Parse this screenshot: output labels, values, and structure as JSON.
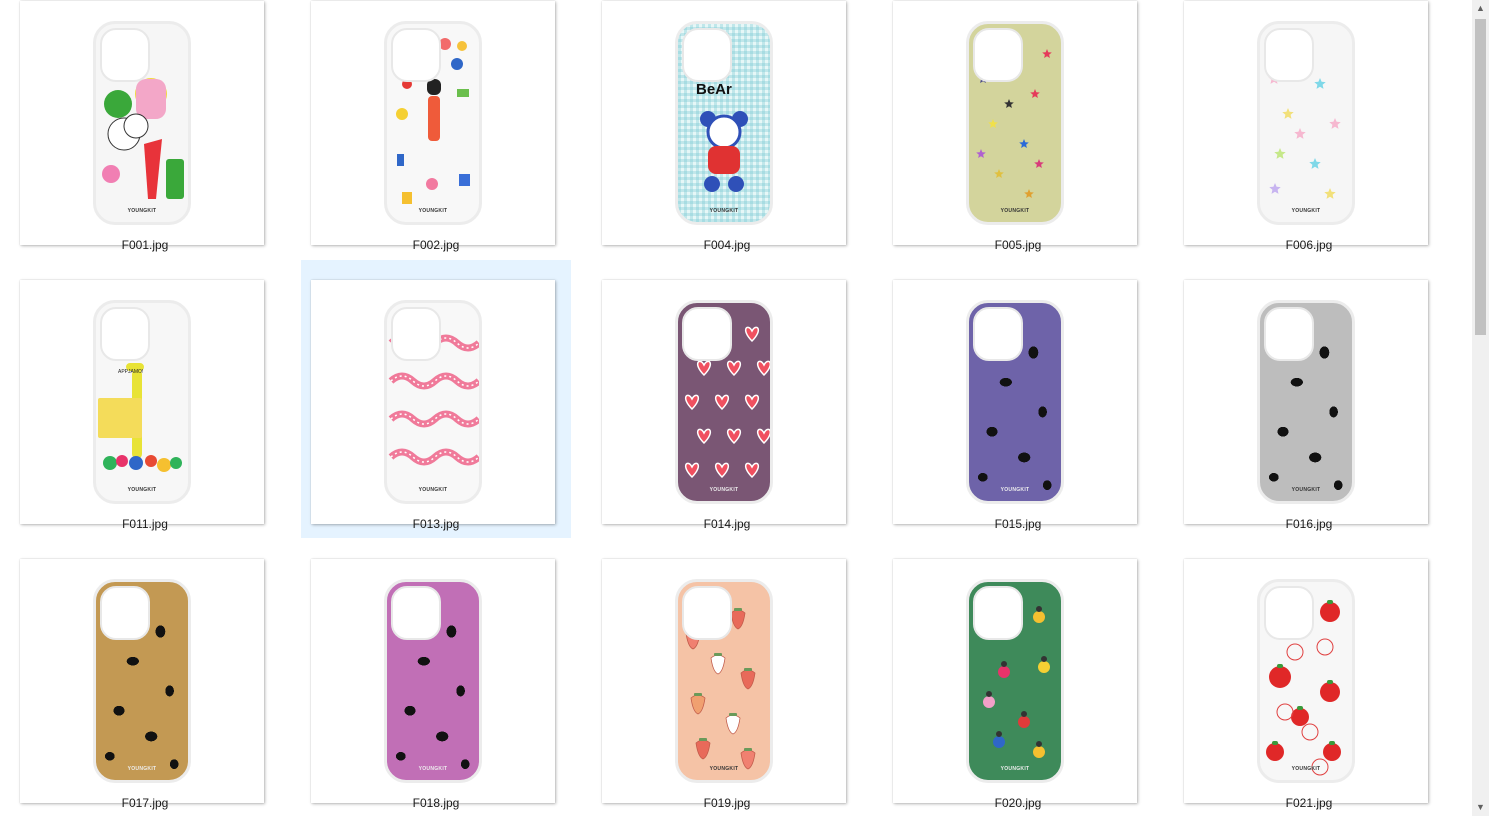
{
  "files": [
    {
      "name": "F001.jpg",
      "design": "doodle-heart-cloud",
      "bg": "#f6f6f6",
      "brand": "YOUNGKIT"
    },
    {
      "name": "F002.jpg",
      "design": "girl-stickers",
      "bg": "#f8f8f8",
      "brand": "YOUNGKIT"
    },
    {
      "name": "F004.jpg",
      "design": "bear-gingham",
      "bg": "#c8ecec",
      "brand": "YOUNGKIT",
      "text": "BeAr"
    },
    {
      "name": "F005.jpg",
      "design": "stars-olive",
      "bg": "#d3d49c",
      "brand": "YOUNGKIT"
    },
    {
      "name": "F006.jpg",
      "design": "pastel-stars",
      "bg": "#f6f6f6",
      "brand": "YOUNGKIT"
    },
    {
      "name": "F011.jpg",
      "design": "dinosaur-box",
      "bg": "#f7f7f7",
      "brand": "YOUNGKIT",
      "text": "APPJAMO!"
    },
    {
      "name": "F013.jpg",
      "design": "pink-snakes",
      "bg": "#f8f8f8",
      "brand": "YOUNGKIT",
      "selected": true
    },
    {
      "name": "F014.jpg",
      "design": "hearts-purple",
      "bg": "#7a5674",
      "brand": "YOUNGKIT"
    },
    {
      "name": "F015.jpg",
      "design": "leopard-purple",
      "bg": "#6e63a9",
      "brand": "YOUNGKIT"
    },
    {
      "name": "F016.jpg",
      "design": "leopard-gray",
      "bg": "#bdbdbd",
      "brand": "YOUNGKIT"
    },
    {
      "name": "F017.jpg",
      "design": "leopard-brown",
      "bg": "#c39953",
      "brand": "YOUNGKIT"
    },
    {
      "name": "F018.jpg",
      "design": "leopard-pink",
      "bg": "#c16fb6",
      "brand": "YOUNGKIT"
    },
    {
      "name": "F019.jpg",
      "design": "strawberries-peach",
      "bg": "#f5c3a6",
      "brand": "YOUNGKIT"
    },
    {
      "name": "F020.jpg",
      "design": "bugs-green",
      "bg": "#3e8a5a",
      "brand": "YOUNGKIT"
    },
    {
      "name": "F021.jpg",
      "design": "tomatoes",
      "bg": "#f7f7f7",
      "brand": "YOUNGKIT"
    }
  ],
  "scrollbar": {
    "up_icon": "▲",
    "down_icon": "▼"
  }
}
